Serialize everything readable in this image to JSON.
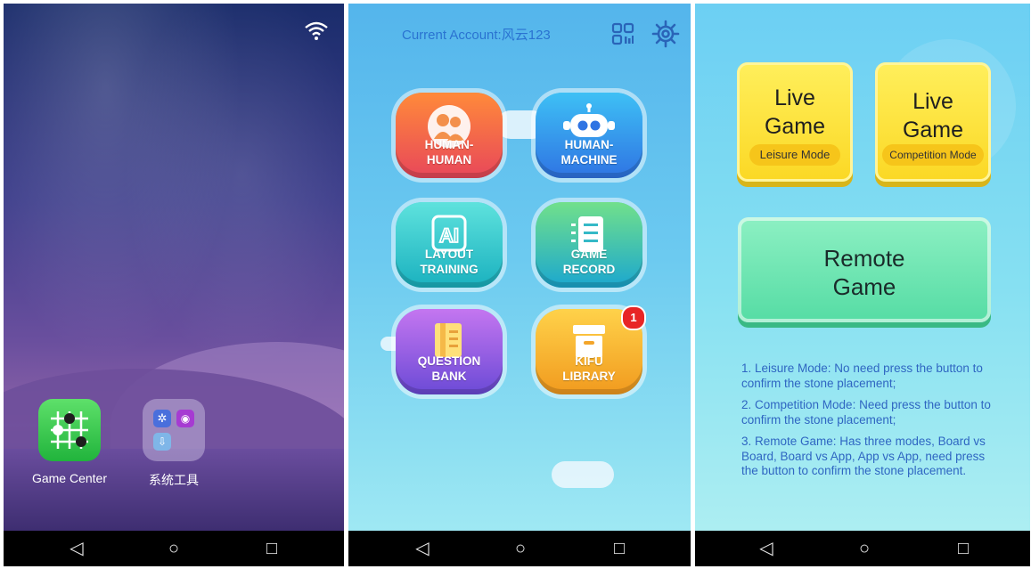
{
  "screen1": {
    "apps": [
      {
        "label": "Game Center",
        "icon": "go-board-icon"
      },
      {
        "label": "系统工具",
        "icon": "folder-icon"
      }
    ],
    "status_icon": "wifi-icon"
  },
  "screen2": {
    "account_label": "Current Account:风云123",
    "menu": [
      {
        "label": "HUMAN-\nHUMAN",
        "icon": "people-icon"
      },
      {
        "label": "HUMAN-\nMACHINE",
        "icon": "robot-icon"
      },
      {
        "label": "LAYOUT\nTRAINING",
        "icon": "ai-icon"
      },
      {
        "label": "GAME\nRECORD",
        "icon": "list-icon"
      },
      {
        "label": "QUESTION\nBANK",
        "icon": "book-icon"
      },
      {
        "label": "KIFU\nLIBRARY",
        "icon": "box-icon",
        "badge": "1"
      }
    ]
  },
  "screen3": {
    "live_leisure": {
      "title": "Live\nGame",
      "mode": "Leisure Mode"
    },
    "live_competition": {
      "title": "Live\nGame",
      "mode": "Competition Mode"
    },
    "remote": {
      "title": "Remote\nGame"
    },
    "notes": [
      "1. Leisure Mode: No need press the button to confirm the stone placement;",
      "2. Competition Mode: Need press the button to confirm the stone placement;",
      "3. Remote Game: Has three modes, Board vs Board, Board vs App, App vs App, need press the button to confirm the stone placement."
    ]
  },
  "navbar": {
    "back": "◁",
    "home": "○",
    "recents": "□"
  }
}
